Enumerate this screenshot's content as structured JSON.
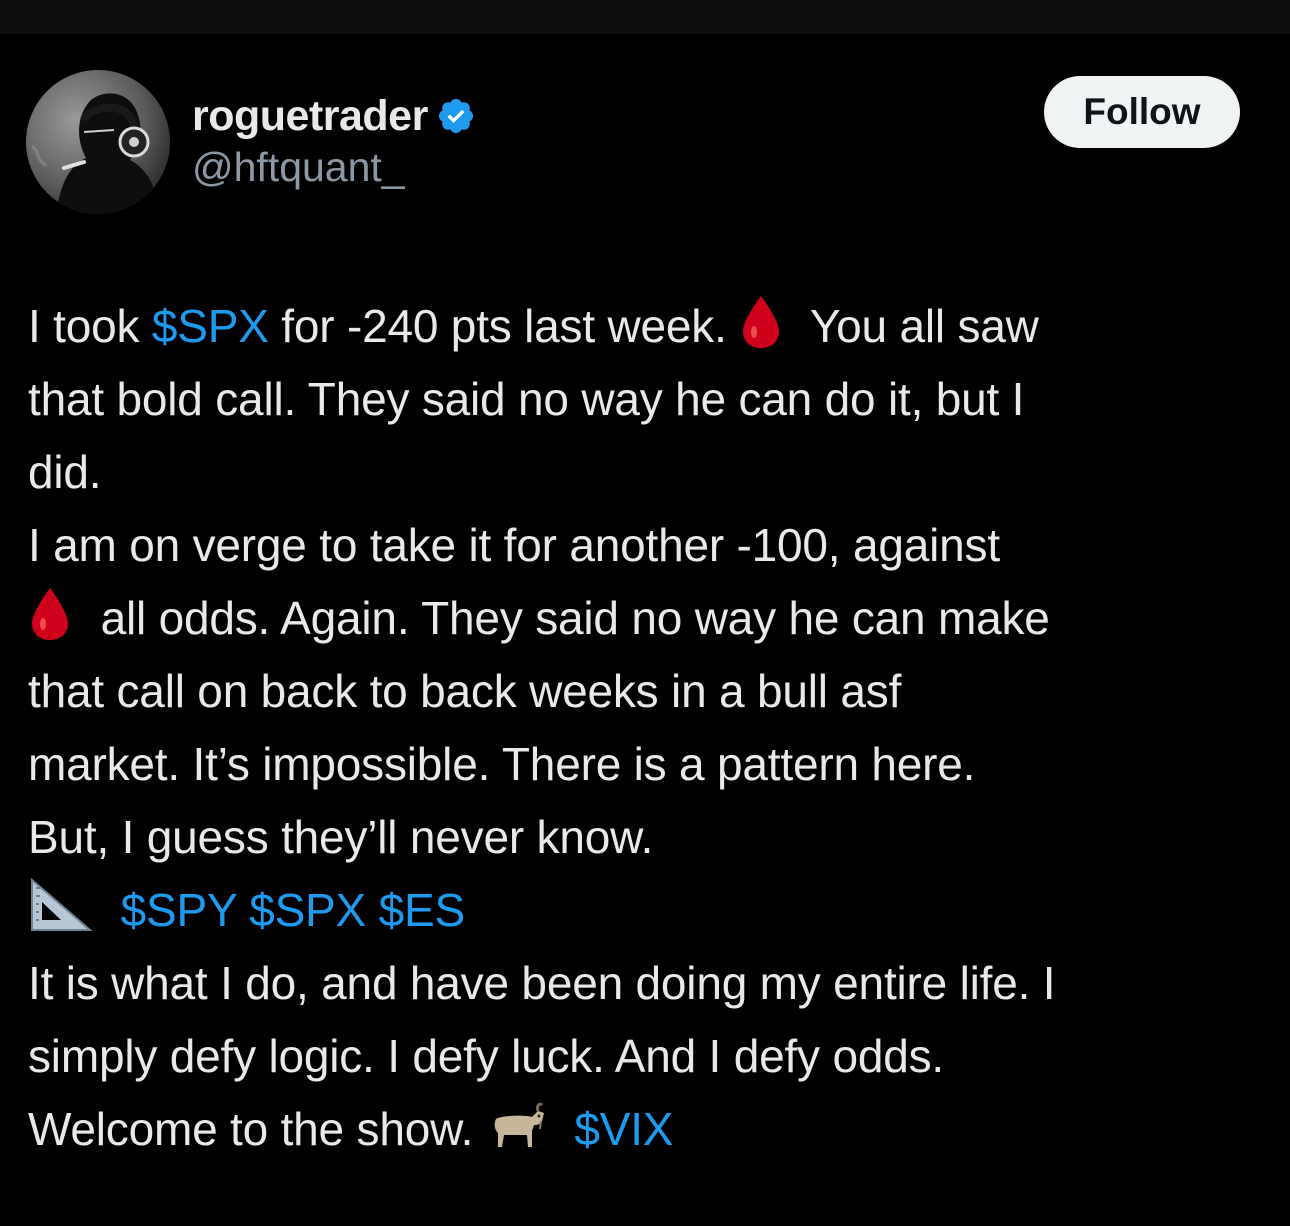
{
  "author": {
    "display_name": "roguetrader",
    "handle": "@hftquant_",
    "verified_icon": "verified-badge-icon",
    "avatar_icon": "avatar-photo"
  },
  "follow_button": {
    "label": "Follow"
  },
  "tweet": {
    "line1": {
      "a": "I took ",
      "cashtag1": "$SPX",
      "b": " for -240 pts last week.",
      "emoji": "drop-of-blood-icon",
      "c": "You all saw"
    },
    "line2": {
      "text": "that bold call. They said no way he can do it, but I"
    },
    "line3": {
      "text": "did."
    },
    "line4": {
      "text": "I am on verge to take it for another -100, against"
    },
    "line5": {
      "emoji": "drop-of-blood-icon",
      "text": "all odds. Again. They said no way he can make"
    },
    "line6": {
      "text": "that call on back to back weeks in a bull asf"
    },
    "line7": {
      "text": "market. It’s impossible. There is a pattern here."
    },
    "line8": {
      "text": "But, I guess they’ll never know."
    },
    "line9": {
      "emoji": "triangular-ruler-icon",
      "cashtag1": "$SPY",
      "cashtag2": "$SPX",
      "cashtag3": "$ES"
    },
    "line10": {
      "text": "It is what I do, and have been doing my entire life. I"
    },
    "line11": {
      "text": "simply defy logic. I defy luck. And I defy odds."
    },
    "line12": {
      "text": "Welcome to the show.",
      "emoji": "goat-icon",
      "cashtag1": "$VIX"
    }
  },
  "colors": {
    "background": "#000000",
    "text": "#e7e9ea",
    "secondary_text": "#8b98a5",
    "link": "#1d9bf0",
    "verified": "#1d9bf0",
    "follow_bg": "#eff3f4"
  }
}
